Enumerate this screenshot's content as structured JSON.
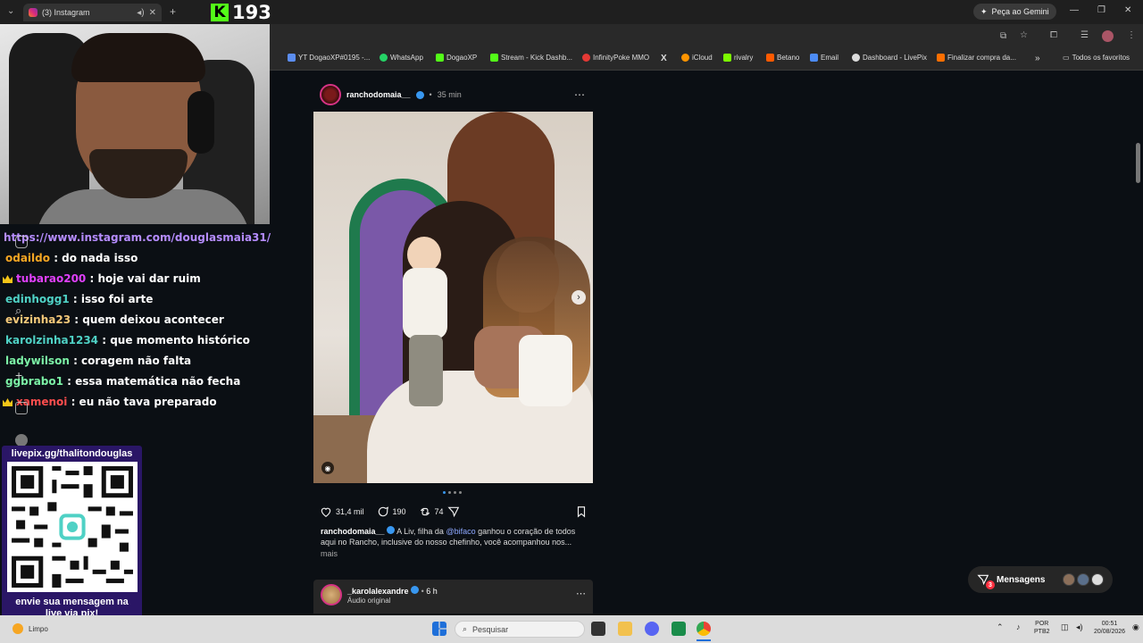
{
  "browser": {
    "tab_title": "(3) Instagram",
    "new_tab_label": "+",
    "gemini_label": "Peça ao Gemini",
    "window_controls": [
      "—",
      "❐",
      "✕"
    ],
    "bookmarks": [
      {
        "label": "YT DogaoXP#0195 -...",
        "color": "#5b8def"
      },
      {
        "label": "WhatsApp",
        "color": "#25d366"
      },
      {
        "label": "DogaoXP",
        "color": "#53fc18"
      },
      {
        "label": "Stream - Kick Dashb...",
        "color": "#53fc18"
      },
      {
        "label": "InfinityPoke MMO",
        "color": "#e53935"
      },
      {
        "label": "X",
        "color": "#000000"
      },
      {
        "label": "iCloud",
        "color": "#ff9500"
      },
      {
        "label": "rivalry",
        "color": "#7cfc00"
      },
      {
        "label": "Betano",
        "color": "#ff5a00"
      },
      {
        "label": "Email",
        "color": "#4c8bf5"
      },
      {
        "label": "Dashboard - LivePix",
        "color": "#dddddd"
      },
      {
        "label": "Finalizar compra da...",
        "color": "#ff6f00"
      }
    ],
    "bookmarks_overflow": "»",
    "all_favorites": "Todos os favoritos"
  },
  "kick": {
    "logo": "K",
    "viewer_count": "193"
  },
  "chat": {
    "link": "https://www.instagram.com/douglasmaia31/",
    "messages": [
      {
        "user": "odaildo",
        "text": ": do nada isso",
        "color": "#f5a623",
        "crown": false
      },
      {
        "user": "tubarao200",
        "text": ": hoje vai dar ruim",
        "color": "#e040fb",
        "crown": true
      },
      {
        "user": "edinhogg1",
        "text": ": isso foi arte",
        "color": "#4fd1c5",
        "crown": false
      },
      {
        "user": "evizinha23",
        "text": ": quem deixou acontecer",
        "color": "#f6c97a",
        "crown": false
      },
      {
        "user": "karolzinha1234",
        "text": ": que momento histórico",
        "color": "#4fd1c5",
        "crown": false
      },
      {
        "user": "ladywilson",
        "text": ": coragem não falta",
        "color": "#7cf2a6",
        "crown": false
      },
      {
        "user": "ggbrabo1",
        "text": ": essa matemática não fecha",
        "color": "#7cf2a6",
        "crown": false
      },
      {
        "user": "xamenoi",
        "text": ": eu não tava preparado",
        "color": "#ff4d4d",
        "crown": true
      }
    ]
  },
  "livepix": {
    "url": "livepix.gg/thalitondouglas",
    "footer_line1": "envie sua mensagem na",
    "footer_line2": "live via pix!"
  },
  "post": {
    "username": "ranchodomaia__",
    "time": "35 min",
    "more_icon": "⋯",
    "likes": "31,4 mil",
    "comments": "190",
    "reposts": "74",
    "caption_user": "ranchodomaia__",
    "caption_pre": "A Liv, filha da",
    "caption_mention": "@bifaco",
    "caption_post": "ganhou o coração de todos aqui no Rancho, inclusive do nosso chefinho, você acompanhou nos...",
    "more_label": "mais",
    "next_arrow": "›"
  },
  "next_post": {
    "username": "_karolalexandre",
    "time": "6 h",
    "audio": "Áudio original"
  },
  "messages_pill": {
    "label": "Mensagens",
    "badge": "3"
  },
  "taskbar": {
    "weather": "Limpo",
    "search_placeholder": "Pesquisar",
    "lang_top": "POR",
    "lang_bottom": "PTB2",
    "time": "00:51",
    "date": "20/08/2026"
  }
}
